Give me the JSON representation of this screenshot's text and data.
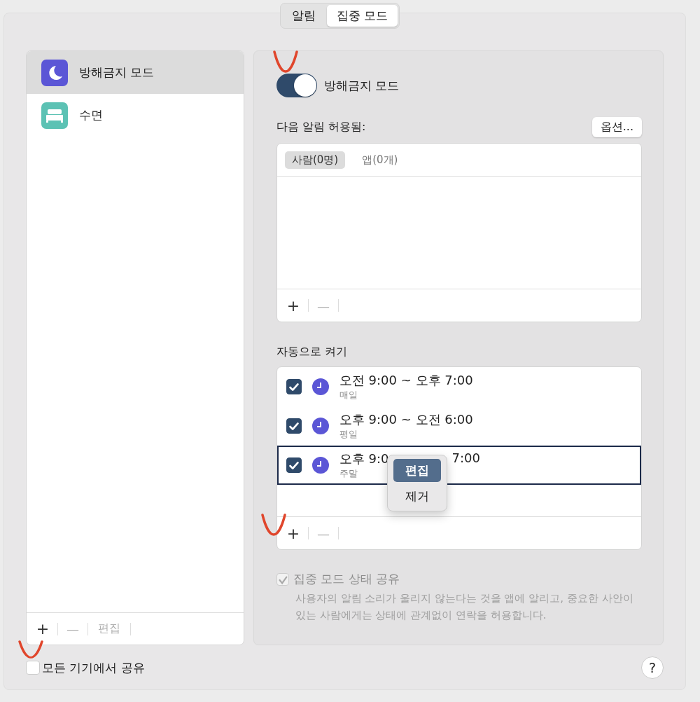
{
  "tabs": [
    {
      "label": "알림",
      "selected": false
    },
    {
      "label": "집중 모드",
      "selected": true
    }
  ],
  "sidebar": {
    "items": [
      {
        "label": "방해금지 모드",
        "kind": "moon",
        "color": "#5b56d6",
        "selected": true
      },
      {
        "label": "수면",
        "kind": "bed",
        "color": "#5cc2b4",
        "selected": false
      }
    ],
    "footer": {
      "add": "+",
      "remove": "—",
      "edit": "편집"
    }
  },
  "detail": {
    "toggle": {
      "label": "방해금지 모드",
      "on": true
    },
    "allowed": {
      "title": "다음 알림 허용됨:",
      "options_button": "옵션...",
      "tabs": [
        {
          "label": "사람(0명)",
          "selected": true
        },
        {
          "label": "앱(0개)",
          "selected": false
        }
      ],
      "add": "+",
      "remove": "—"
    },
    "auto": {
      "title": "자동으로 켜기",
      "schedules": [
        {
          "title_parts": [
            "오전 9:00 ~ 오후 7:00"
          ],
          "days": "매일",
          "checked": true,
          "selected": false
        },
        {
          "title_parts": [
            "오후 9:00 ~ 오전 6:00"
          ],
          "days": "평일",
          "checked": true,
          "selected": false
        },
        {
          "title_parts": [
            "오후 9:0",
            "7:00"
          ],
          "days": "주말",
          "checked": true,
          "selected": true
        }
      ],
      "add": "+",
      "remove": "—",
      "context_menu": [
        {
          "label": "편집",
          "selected": true
        },
        {
          "label": "제거",
          "selected": false
        }
      ]
    },
    "share_status": {
      "label": "집중 모드 상태 공유",
      "checked": true,
      "disabled": true,
      "description": "사용자의 알림 소리가 울리지 않는다는 것을 앱에 알리고, 중요한 사안이 있는 사람에게는 상태에 관계없이 연락을 허용합니다."
    }
  },
  "share_devices": {
    "label": "모든 기기에서 공유",
    "checked": false
  },
  "help": "?"
}
